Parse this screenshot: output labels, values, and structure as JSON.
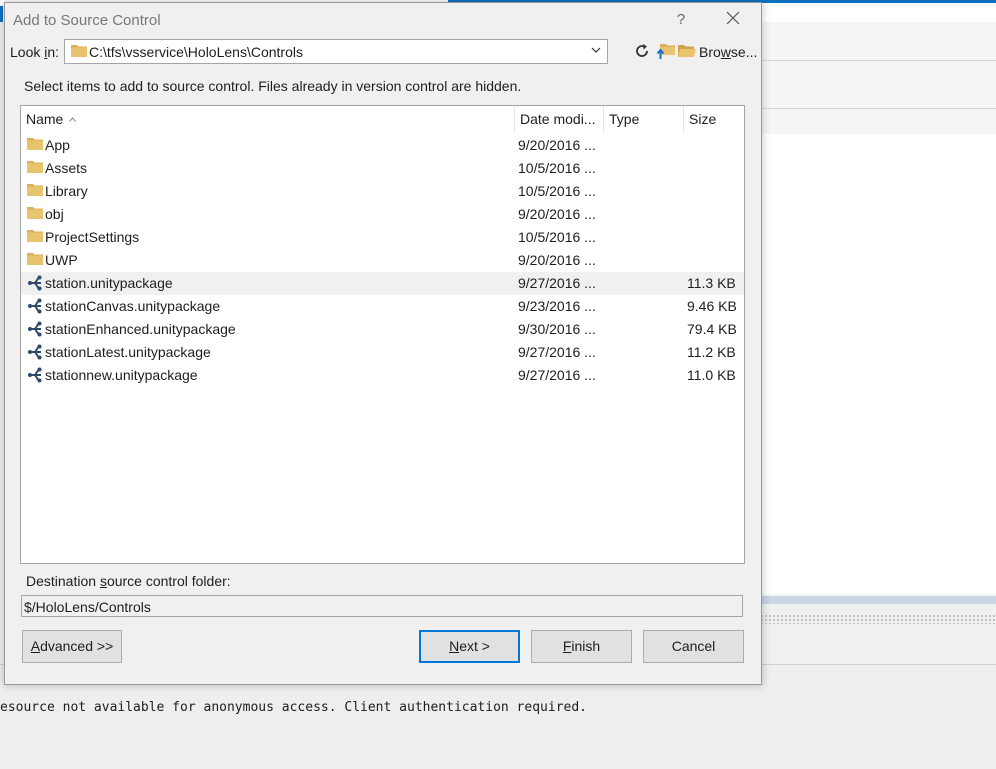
{
  "dialog": {
    "title": "Add to Source Control",
    "help_label": "?",
    "look_in": {
      "label_prefix": "Look ",
      "label_access": "i",
      "label_suffix": "n:",
      "path": "C:\\tfs\\vsservice\\HoloLens\\Controls"
    },
    "browse": {
      "access": "w",
      "pre": "Bro",
      "post": "se..."
    },
    "instructions": "Select items to add to source control. Files already in version control are hidden.",
    "columns": {
      "name": "Name",
      "date": "Date modi...",
      "type": "Type",
      "size": "Size"
    },
    "items": [
      {
        "name": "App",
        "date": "9/20/2016 ...",
        "type": "",
        "size": "",
        "icon": "folder-icon"
      },
      {
        "name": "Assets",
        "date": "10/5/2016 ...",
        "type": "",
        "size": "",
        "icon": "folder-icon"
      },
      {
        "name": "Library",
        "date": "10/5/2016 ...",
        "type": "",
        "size": "",
        "icon": "folder-icon"
      },
      {
        "name": "obj",
        "date": "9/20/2016 ...",
        "type": "",
        "size": "",
        "icon": "folder-icon"
      },
      {
        "name": "ProjectSettings",
        "date": "10/5/2016 ...",
        "type": "",
        "size": "",
        "icon": "folder-icon"
      },
      {
        "name": "UWP",
        "date": "9/20/2016 ...",
        "type": "",
        "size": "",
        "icon": "folder-icon"
      },
      {
        "name": "station.unitypackage",
        "date": "9/27/2016 ...",
        "type": "",
        "size": "11.3 KB",
        "icon": "unity-package-icon"
      },
      {
        "name": "stationCanvas.unitypackage",
        "date": "9/23/2016 ...",
        "type": "",
        "size": "9.46 KB",
        "icon": "unity-package-icon"
      },
      {
        "name": "stationEnhanced.unitypackage",
        "date": "9/30/2016 ...",
        "type": "",
        "size": "79.4 KB",
        "icon": "unity-package-icon"
      },
      {
        "name": "stationLatest.unitypackage",
        "date": "9/27/2016 ...",
        "type": "",
        "size": "11.2 KB",
        "icon": "unity-package-icon"
      },
      {
        "name": "stationnew.unitypackage",
        "date": "9/27/2016 ...",
        "type": "",
        "size": "11.0 KB",
        "icon": "unity-package-icon"
      }
    ],
    "destination": {
      "label_pre": "Destination ",
      "label_access": "s",
      "label_post": "ource control folder:",
      "value": "$/HoloLens/Controls"
    },
    "buttons": {
      "advanced": {
        "access": "A",
        "rest": "dvanced >>"
      },
      "next": {
        "access": "N",
        "rest": "ext >"
      },
      "finish": {
        "access": "F",
        "rest": "inish"
      },
      "cancel": "Cancel"
    }
  },
  "output": {
    "text": "esource not available for anonymous access. Client authentication required."
  },
  "colors": {
    "accent": "#0078d7",
    "folder": "#dcb05a",
    "unity_icon": "#2d4a6b"
  }
}
